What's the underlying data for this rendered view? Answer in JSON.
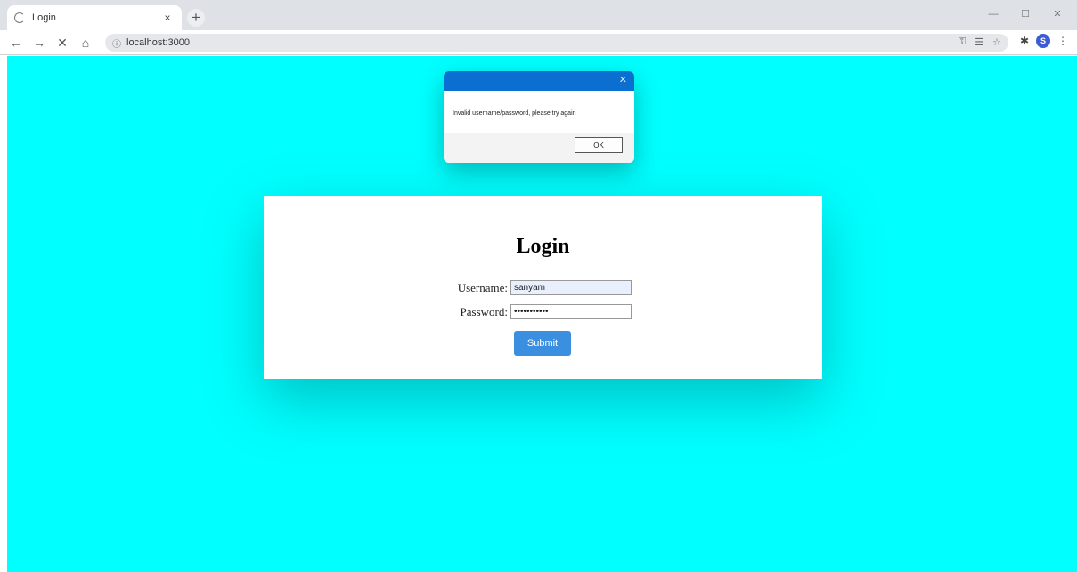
{
  "browser": {
    "tab_title": "Login",
    "tab_close": "×",
    "new_tab": "+",
    "url": "localhost:3000",
    "window_controls": [
      "—",
      "☐",
      "✕"
    ]
  },
  "toolbar": {
    "back": "←",
    "forward": "→",
    "stop": "✕",
    "home": "⌂",
    "site_info": "ⓘ",
    "omnibox_icons": [
      "⚿",
      "☰",
      "☆"
    ],
    "extensions": "✱",
    "avatar_letter": "S",
    "menu": "⋮"
  },
  "alert": {
    "close": "✕",
    "message": "Invalid username/password, please try again",
    "ok_label": "OK",
    "colors": {
      "title_bar": "#0a6fd1"
    }
  },
  "login": {
    "title": "Login",
    "username_label": "Username:",
    "username_value": "sanyam",
    "password_label": "Password:",
    "password_value": "secretpass1",
    "submit_label": "Submit"
  },
  "colors": {
    "page_background": "#00ffff",
    "submit_button": "#3b8fe0",
    "avatar": "#3c5bd6"
  }
}
